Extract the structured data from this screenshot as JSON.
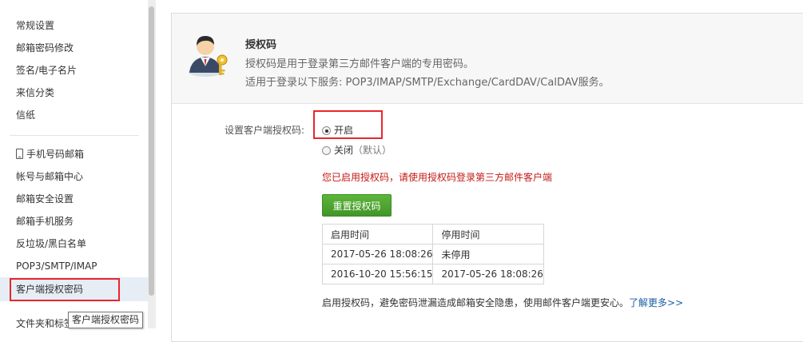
{
  "sidebar": {
    "items": [
      {
        "label": "常规设置"
      },
      {
        "label": "邮箱密码修改"
      },
      {
        "label": "签名/电子名片"
      },
      {
        "label": "来信分类"
      },
      {
        "label": "信纸"
      },
      {
        "label": "手机号码邮箱"
      },
      {
        "label": "帐号与邮箱中心"
      },
      {
        "label": "邮箱安全设置"
      },
      {
        "label": "邮箱手机服务"
      },
      {
        "label": "反垃圾/黑白名单"
      },
      {
        "label": "POP3/SMTP/IMAP"
      },
      {
        "label": "客户端授权密码"
      },
      {
        "label": "文件夹和标签"
      }
    ],
    "active_label": "客户端授权密码",
    "tooltip": "客户端授权密码"
  },
  "header": {
    "title": "授权码",
    "desc1": "授权码是用于登录第三方邮件客户端的专用密码。",
    "desc2": "适用于登录以下服务: POP3/IMAP/SMTP/Exchange/CardDAV/CalDAV服务。",
    "icon": "user-key-icon"
  },
  "form": {
    "label": "设置客户端授权码:",
    "option_on": "开启",
    "option_off": "关闭",
    "option_off_note": "（默认）",
    "selected": "开启",
    "warning": "您已启用授权码，请使用授权码登录第三方邮件客户端",
    "reset_button": "重置授权码"
  },
  "table": {
    "headers": [
      "启用时间",
      "停用时间"
    ],
    "rows": [
      [
        "2017-05-26 18:08:26",
        "未停用"
      ],
      [
        "2016-10-20 15:56:15",
        "2017-05-26 18:08:26"
      ]
    ]
  },
  "footer": {
    "note": "启用授权码，避免密码泄漏造成邮箱安全隐患，使用邮件客户端更安心。",
    "link": "了解更多>>"
  },
  "colors": {
    "warning": "#c41a16",
    "button": "#4ea632",
    "link": "#1a5ea6",
    "highlight_box": "#e8262d"
  }
}
